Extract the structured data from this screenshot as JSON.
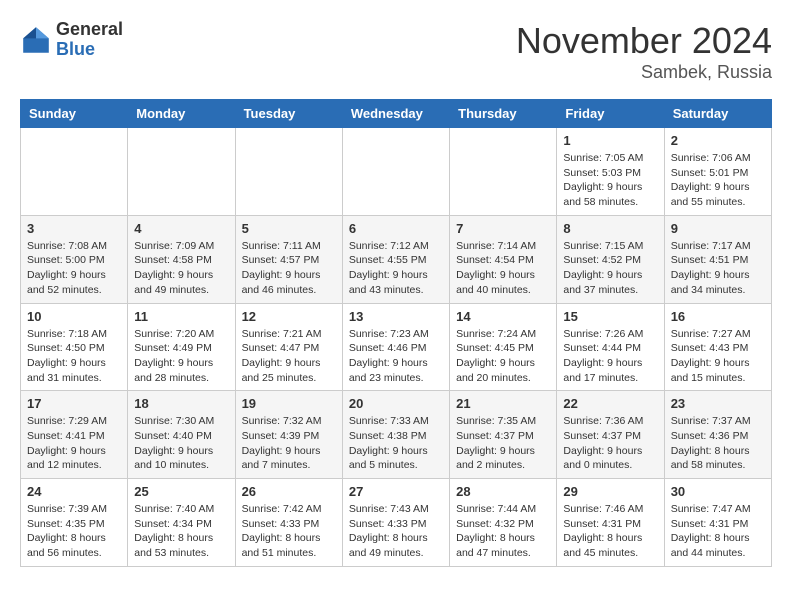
{
  "logo": {
    "general": "General",
    "blue": "Blue"
  },
  "title": {
    "month": "November 2024",
    "location": "Sambek, Russia"
  },
  "headers": [
    "Sunday",
    "Monday",
    "Tuesday",
    "Wednesday",
    "Thursday",
    "Friday",
    "Saturday"
  ],
  "weeks": [
    [
      {
        "day": "",
        "info": ""
      },
      {
        "day": "",
        "info": ""
      },
      {
        "day": "",
        "info": ""
      },
      {
        "day": "",
        "info": ""
      },
      {
        "day": "",
        "info": ""
      },
      {
        "day": "1",
        "info": "Sunrise: 7:05 AM\nSunset: 5:03 PM\nDaylight: 9 hours and 58 minutes."
      },
      {
        "day": "2",
        "info": "Sunrise: 7:06 AM\nSunset: 5:01 PM\nDaylight: 9 hours and 55 minutes."
      }
    ],
    [
      {
        "day": "3",
        "info": "Sunrise: 7:08 AM\nSunset: 5:00 PM\nDaylight: 9 hours and 52 minutes."
      },
      {
        "day": "4",
        "info": "Sunrise: 7:09 AM\nSunset: 4:58 PM\nDaylight: 9 hours and 49 minutes."
      },
      {
        "day": "5",
        "info": "Sunrise: 7:11 AM\nSunset: 4:57 PM\nDaylight: 9 hours and 46 minutes."
      },
      {
        "day": "6",
        "info": "Sunrise: 7:12 AM\nSunset: 4:55 PM\nDaylight: 9 hours and 43 minutes."
      },
      {
        "day": "7",
        "info": "Sunrise: 7:14 AM\nSunset: 4:54 PM\nDaylight: 9 hours and 40 minutes."
      },
      {
        "day": "8",
        "info": "Sunrise: 7:15 AM\nSunset: 4:52 PM\nDaylight: 9 hours and 37 minutes."
      },
      {
        "day": "9",
        "info": "Sunrise: 7:17 AM\nSunset: 4:51 PM\nDaylight: 9 hours and 34 minutes."
      }
    ],
    [
      {
        "day": "10",
        "info": "Sunrise: 7:18 AM\nSunset: 4:50 PM\nDaylight: 9 hours and 31 minutes."
      },
      {
        "day": "11",
        "info": "Sunrise: 7:20 AM\nSunset: 4:49 PM\nDaylight: 9 hours and 28 minutes."
      },
      {
        "day": "12",
        "info": "Sunrise: 7:21 AM\nSunset: 4:47 PM\nDaylight: 9 hours and 25 minutes."
      },
      {
        "day": "13",
        "info": "Sunrise: 7:23 AM\nSunset: 4:46 PM\nDaylight: 9 hours and 23 minutes."
      },
      {
        "day": "14",
        "info": "Sunrise: 7:24 AM\nSunset: 4:45 PM\nDaylight: 9 hours and 20 minutes."
      },
      {
        "day": "15",
        "info": "Sunrise: 7:26 AM\nSunset: 4:44 PM\nDaylight: 9 hours and 17 minutes."
      },
      {
        "day": "16",
        "info": "Sunrise: 7:27 AM\nSunset: 4:43 PM\nDaylight: 9 hours and 15 minutes."
      }
    ],
    [
      {
        "day": "17",
        "info": "Sunrise: 7:29 AM\nSunset: 4:41 PM\nDaylight: 9 hours and 12 minutes."
      },
      {
        "day": "18",
        "info": "Sunrise: 7:30 AM\nSunset: 4:40 PM\nDaylight: 9 hours and 10 minutes."
      },
      {
        "day": "19",
        "info": "Sunrise: 7:32 AM\nSunset: 4:39 PM\nDaylight: 9 hours and 7 minutes."
      },
      {
        "day": "20",
        "info": "Sunrise: 7:33 AM\nSunset: 4:38 PM\nDaylight: 9 hours and 5 minutes."
      },
      {
        "day": "21",
        "info": "Sunrise: 7:35 AM\nSunset: 4:37 PM\nDaylight: 9 hours and 2 minutes."
      },
      {
        "day": "22",
        "info": "Sunrise: 7:36 AM\nSunset: 4:37 PM\nDaylight: 9 hours and 0 minutes."
      },
      {
        "day": "23",
        "info": "Sunrise: 7:37 AM\nSunset: 4:36 PM\nDaylight: 8 hours and 58 minutes."
      }
    ],
    [
      {
        "day": "24",
        "info": "Sunrise: 7:39 AM\nSunset: 4:35 PM\nDaylight: 8 hours and 56 minutes."
      },
      {
        "day": "25",
        "info": "Sunrise: 7:40 AM\nSunset: 4:34 PM\nDaylight: 8 hours and 53 minutes."
      },
      {
        "day": "26",
        "info": "Sunrise: 7:42 AM\nSunset: 4:33 PM\nDaylight: 8 hours and 51 minutes."
      },
      {
        "day": "27",
        "info": "Sunrise: 7:43 AM\nSunset: 4:33 PM\nDaylight: 8 hours and 49 minutes."
      },
      {
        "day": "28",
        "info": "Sunrise: 7:44 AM\nSunset: 4:32 PM\nDaylight: 8 hours and 47 minutes."
      },
      {
        "day": "29",
        "info": "Sunrise: 7:46 AM\nSunset: 4:31 PM\nDaylight: 8 hours and 45 minutes."
      },
      {
        "day": "30",
        "info": "Sunrise: 7:47 AM\nSunset: 4:31 PM\nDaylight: 8 hours and 44 minutes."
      }
    ]
  ]
}
